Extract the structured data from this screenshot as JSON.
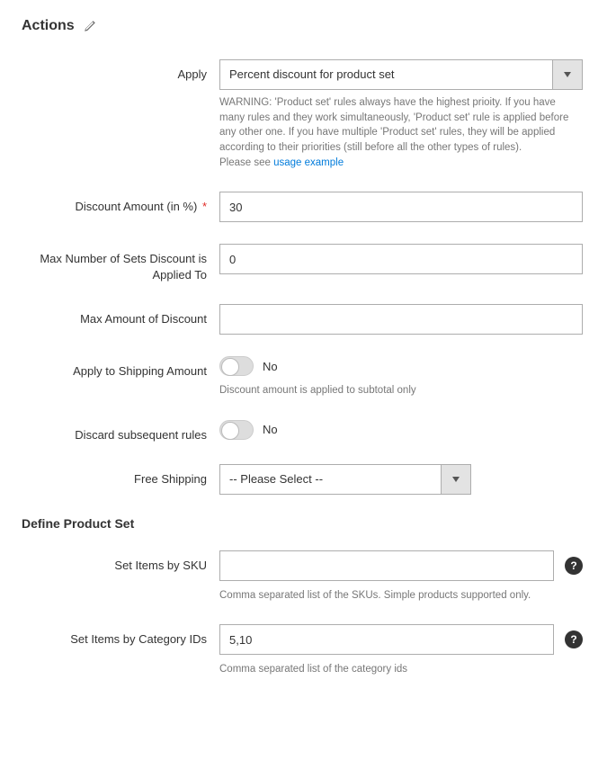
{
  "section_title": "Actions",
  "fields": {
    "apply": {
      "label": "Apply",
      "value": "Percent discount for product set",
      "warning_prefix": "WARNING: 'Product set' rules always have the highest prioity. If you have many rules and they work simultaneously, 'Product set' rule is applied before any other one. If you have multiple 'Product set' rules, they will be applied according to their priorities (still before all the other types of rules).",
      "warning_suffix": "Please see ",
      "warning_link": "usage example"
    },
    "discount_amount": {
      "label": "Discount Amount (in %)",
      "value": "30"
    },
    "max_sets": {
      "label": "Max Number of Sets Discount is Applied To",
      "value": "0"
    },
    "max_discount": {
      "label": "Max Amount of Discount",
      "value": ""
    },
    "apply_shipping": {
      "label": "Apply to Shipping Amount",
      "value": "No",
      "note": "Discount amount is applied to subtotal only"
    },
    "discard_rules": {
      "label": "Discard subsequent rules",
      "value": "No"
    },
    "free_shipping": {
      "label": "Free Shipping",
      "value": "-- Please Select --"
    }
  },
  "subsection": "Define Product Set",
  "set_sku": {
    "label": "Set Items by SKU",
    "value": "",
    "note": "Comma separated list of the SKUs. Simple products supported only."
  },
  "set_category": {
    "label": "Set Items by Category IDs",
    "value": "5,10",
    "note": "Comma separated list of the category ids"
  }
}
